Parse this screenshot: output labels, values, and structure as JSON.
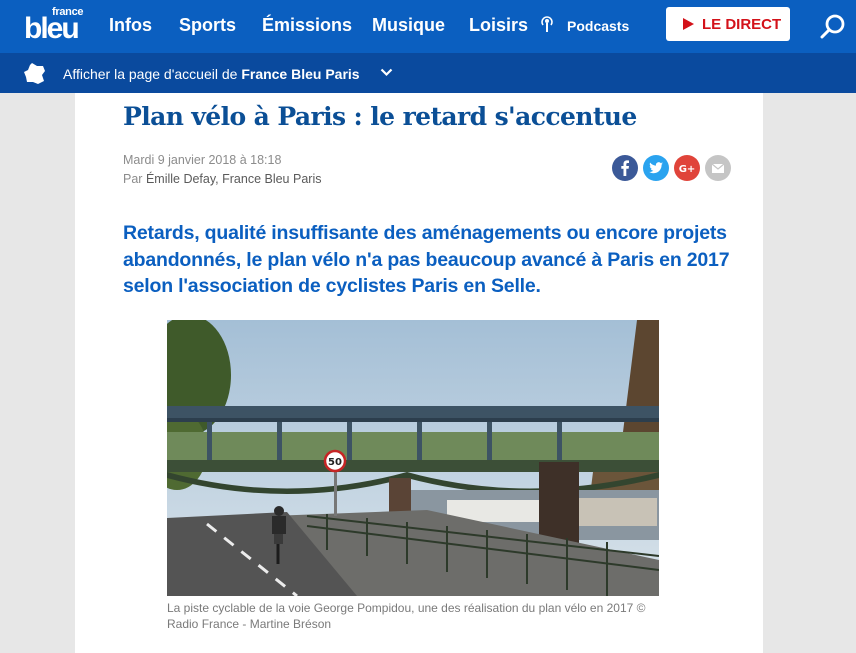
{
  "header": {
    "logo_small": "france",
    "logo_big": "bleu",
    "nav": [
      "Infos",
      "Sports",
      "Émissions",
      "Musique",
      "Loisirs"
    ],
    "podcasts_label": "Podcasts",
    "direct_label": "LE DIRECT",
    "brand_color": "#0b5fc0"
  },
  "localbar": {
    "text": "Afficher la page d'accueil de ",
    "station": "France Bleu Paris"
  },
  "article": {
    "title": "Plan vélo à Paris : le retard s'accentue",
    "date": "Mardi 9 janvier 2018 à 18:18",
    "by": "Par ",
    "author": "Émille Defay",
    "station": ", France Bleu Paris",
    "lead": "Retards, qualité insuffisante des aménagements ou encore projets abandonnés, le plan vélo n'a pas beaucoup avancé à Paris en 2017 selon l'association de cyclistes Paris en Selle.",
    "caption": "La piste cyclable de la voie George Pompidou, une des réalisation du plan vélo en 2017 © Radio France - Martine Bréson",
    "speed_sign": "50"
  },
  "share": [
    "facebook-icon",
    "twitter-icon",
    "google-plus-icon",
    "email-icon"
  ]
}
